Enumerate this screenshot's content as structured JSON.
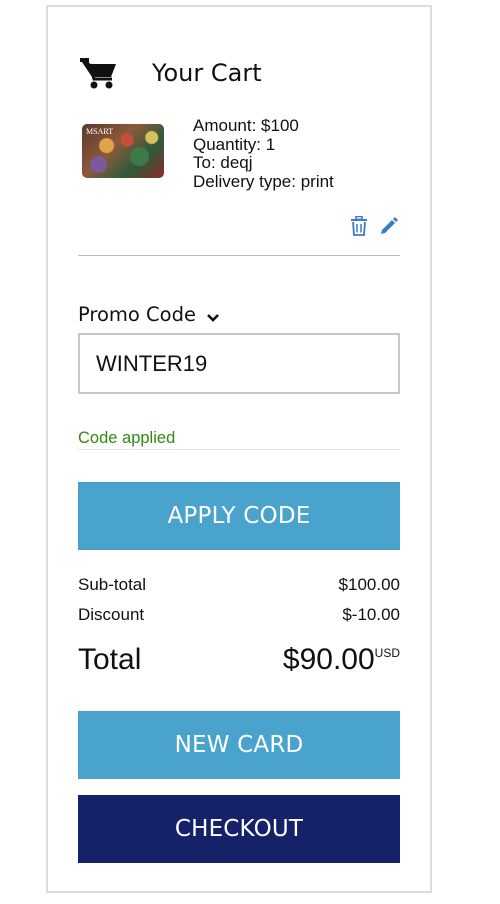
{
  "cart": {
    "title": "Your Cart",
    "icon": "shopping-cart-icon"
  },
  "item": {
    "thumbnail_text": "MSART",
    "amount": "Amount: $100",
    "quantity": "Quantity: 1",
    "to": "To: deqj",
    "delivery": "Delivery type: print",
    "delete_icon": "trash-icon",
    "edit_icon": "pencil-icon"
  },
  "promo": {
    "label": "Promo Code",
    "value": "WINTER19",
    "status": "Code applied",
    "apply_label": "APPLY CODE"
  },
  "summary": {
    "subtotal_label": "Sub-total",
    "subtotal_value": "$100.00",
    "discount_label": "Discount",
    "discount_value": "$-10.00",
    "total_label": "Total",
    "total_value": "$90.00",
    "currency": "USD"
  },
  "actions": {
    "new_card_label": "NEW CARD",
    "checkout_label": "CHECKOUT"
  },
  "colors": {
    "primary_button": "#4aa3cc",
    "checkout_button": "#15226a",
    "success_text": "#2f8a14",
    "icon_accent": "#3a7bc8"
  }
}
